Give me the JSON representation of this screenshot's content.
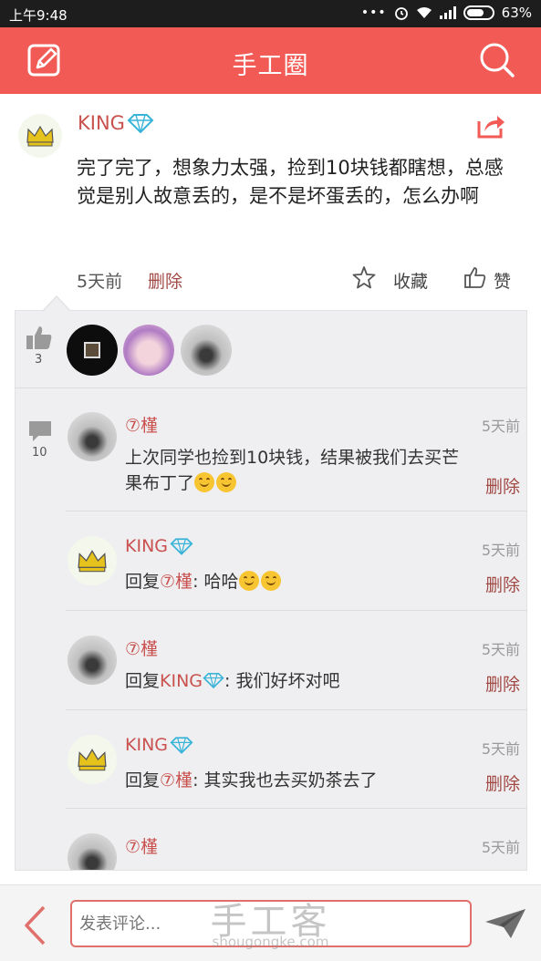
{
  "status_bar": {
    "time": "上午9:48",
    "battery": "63%"
  },
  "header": {
    "title": "手工圈",
    "edit_icon": "edit-icon",
    "search_icon": "search-icon"
  },
  "post": {
    "author": "KING",
    "content": "完了完了，想象力太强，捡到10块钱都瞎想，总感觉是别人故意丢的，是不是坏蛋丢的，怎么办啊",
    "time": "5天前",
    "delete": "删除",
    "favorite": "收藏",
    "like": "赞"
  },
  "likes": {
    "count": "3"
  },
  "comments_count": "10",
  "comments": [
    {
      "name": "⑦槿",
      "time": "5天前",
      "text": "上次同学也捡到10块钱，结果被我们去买芒果布丁了",
      "delete": "删除"
    },
    {
      "name": "KING",
      "time": "5天前",
      "reply_prefix": "回复",
      "reply_to": "⑦槿",
      "text": ": 哈哈",
      "delete": "删除"
    },
    {
      "name": "⑦槿",
      "time": "5天前",
      "reply_prefix": "回复",
      "reply_to": "KING",
      "text": ": 我们好坏对吧",
      "delete": "删除"
    },
    {
      "name": "KING",
      "time": "5天前",
      "reply_prefix": "回复",
      "reply_to": "⑦槿",
      "text": ": 其实我也去买奶茶去了",
      "delete": "删除"
    },
    {
      "name": "⑦槿",
      "time": "5天前"
    }
  ],
  "bottom_bar": {
    "placeholder": "发表评论..."
  },
  "watermark": {
    "cn": "手工客",
    "en": "shougongke.com"
  },
  "colors": {
    "accent": "#f25a55",
    "name": "#c9514e",
    "delete": "#a14944"
  }
}
